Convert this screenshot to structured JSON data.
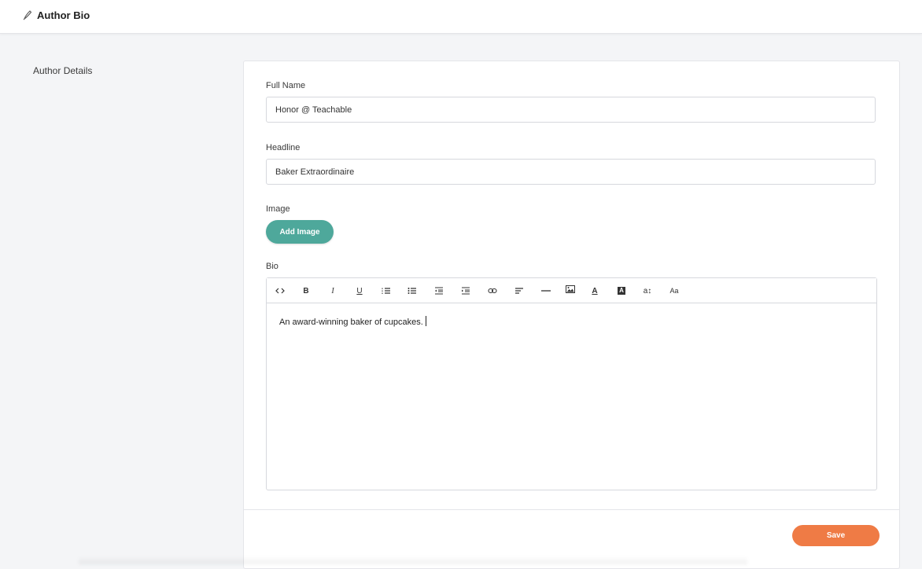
{
  "header": {
    "title": "Author Bio",
    "icon": "pen-nib-icon"
  },
  "sidebar": {
    "section_label": "Author Details"
  },
  "form": {
    "full_name": {
      "label": "Full Name",
      "value": "Honor @ Teachable"
    },
    "headline": {
      "label": "Headline",
      "value": "Baker Extraordinaire"
    },
    "image": {
      "label": "Image",
      "button_label": "Add Image"
    },
    "bio": {
      "label": "Bio",
      "content": "An award-winning baker of cupcakes.",
      "toolbar": {
        "bold": "B",
        "italic": "I",
        "underline": "U",
        "text_color": "A",
        "highlight": "A",
        "font_size": "a↕",
        "font_family": "Aa"
      }
    },
    "save_label": "Save"
  },
  "colors": {
    "accent_teal": "#4ea89b",
    "save_orange": "#ef7b45",
    "background": "#f4f5f7"
  }
}
